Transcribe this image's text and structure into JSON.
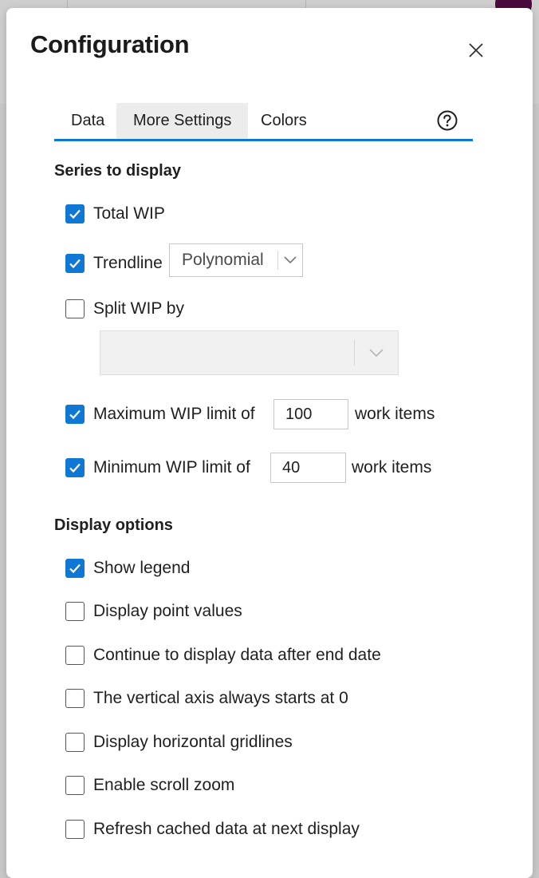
{
  "dialog": {
    "title": "Configuration",
    "close_icon": "close-icon"
  },
  "tabs": [
    {
      "label": "Data",
      "selected": false
    },
    {
      "label": "More Settings",
      "selected": true
    },
    {
      "label": "Colors",
      "selected": false
    }
  ],
  "help_icon": "question-circle-icon",
  "series": {
    "title": "Series to display",
    "total_wip": {
      "label": "Total WIP",
      "checked": true
    },
    "trendline": {
      "label": "Trendline",
      "checked": true,
      "type_value": "Polynomial"
    },
    "split_wip": {
      "label": "Split WIP by",
      "checked": false,
      "value": ""
    },
    "max_wip": {
      "label": "Maximum WIP limit of",
      "checked": true,
      "value": "100",
      "suffix": "work items"
    },
    "min_wip": {
      "label": "Minimum WIP limit of",
      "checked": true,
      "value": "40",
      "suffix": "work items"
    }
  },
  "display": {
    "title": "Display options",
    "options": [
      {
        "label": "Show legend",
        "checked": true
      },
      {
        "label": "Display point values",
        "checked": false
      },
      {
        "label": "Continue to display data after end date",
        "checked": false
      },
      {
        "label": "The vertical axis always starts at 0",
        "checked": false
      },
      {
        "label": "Display horizontal gridlines",
        "checked": false
      },
      {
        "label": "Enable scroll zoom",
        "checked": false
      },
      {
        "label": "Refresh cached data at next display",
        "checked": false
      }
    ]
  },
  "colors": {
    "accent": "#0f78d4",
    "tab_selected_bg": "#ececec",
    "avatar": "#4b0a3d"
  }
}
